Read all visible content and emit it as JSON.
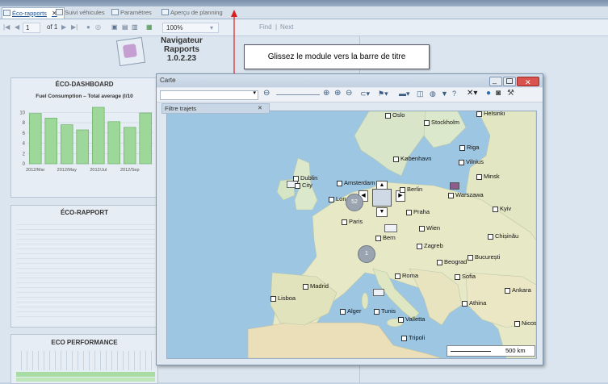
{
  "tabs": [
    {
      "label": "Éco-rapports",
      "active": true
    },
    {
      "label": "Suivi véhicules",
      "active": false
    },
    {
      "label": "Paramètres",
      "active": false
    },
    {
      "label": "Aperçu de planning",
      "active": false
    }
  ],
  "toolbar": {
    "page_current": "1",
    "page_of": "of 1",
    "zoom": "100%",
    "find": "Find",
    "next": "Next"
  },
  "report": {
    "app_name": "Navigateur",
    "app_name2": "Rapports",
    "version": "1.0.2.23",
    "eco_dashboard": {
      "title": "ÉCO-DASHBOARD",
      "chart_title": "Fuel Consumption – Total average (l/10"
    },
    "eco_rapport_title": "ÉCO-RAPPORT",
    "eco_performance_title": "ECO PERFORMANCE"
  },
  "chart_data": {
    "type": "bar",
    "title": "Fuel Consumption – Total average (l/10",
    "categories": [
      "2012/Mar",
      "",
      "2012/May",
      "",
      "2012/Jul",
      "",
      "2012/Sep",
      ""
    ],
    "values": [
      9.8,
      8.9,
      7.6,
      6.6,
      11.0,
      8.2,
      7.1,
      9.9
    ],
    "yticks": [
      "0",
      "2",
      "4",
      "6",
      "8",
      "10"
    ],
    "ylim": [
      0,
      11
    ],
    "bar_color": "#9ed79a",
    "grid": true
  },
  "dialog": {
    "title": "Carte",
    "filter_label": "Filtre trajets",
    "scale_label": "500 km"
  },
  "callout": {
    "text": "Glissez le module vers la barre de titre"
  },
  "map": {
    "cities": {
      "helsinki": "Helsinki",
      "oslo": "Oslo",
      "stockholm": "Stockholm",
      "riga": "Riga",
      "kobenhavn": "København",
      "vilnius": "Vilnius",
      "minsk": "Minsk",
      "dublin": "Dublin",
      "city": "City",
      "amsterdam": "Amsterdam",
      "berlin": "Berlin",
      "warszawa": "Warszawa",
      "london": "Lon",
      "praha": "Praha",
      "kyiv": "Kyiv",
      "paris": "Paris",
      "wien": "Wien",
      "chisinau": "Chișinău",
      "bern": "Bern",
      "zagreb": "Zagreb",
      "beograd": "Beograd",
      "bucuresti": "București",
      "sofia": "Sofia",
      "roma": "Roma",
      "madrid": "Madrid",
      "ankara": "Ankara",
      "lisboa": "Lisboa",
      "athina": "Athina",
      "alger": "Alger",
      "tunis": "Tunis",
      "valletta": "Valletta",
      "nicosia": "Nicosi",
      "tripoli": "Tripoli"
    },
    "cluster1": "52",
    "cluster2": "1"
  }
}
